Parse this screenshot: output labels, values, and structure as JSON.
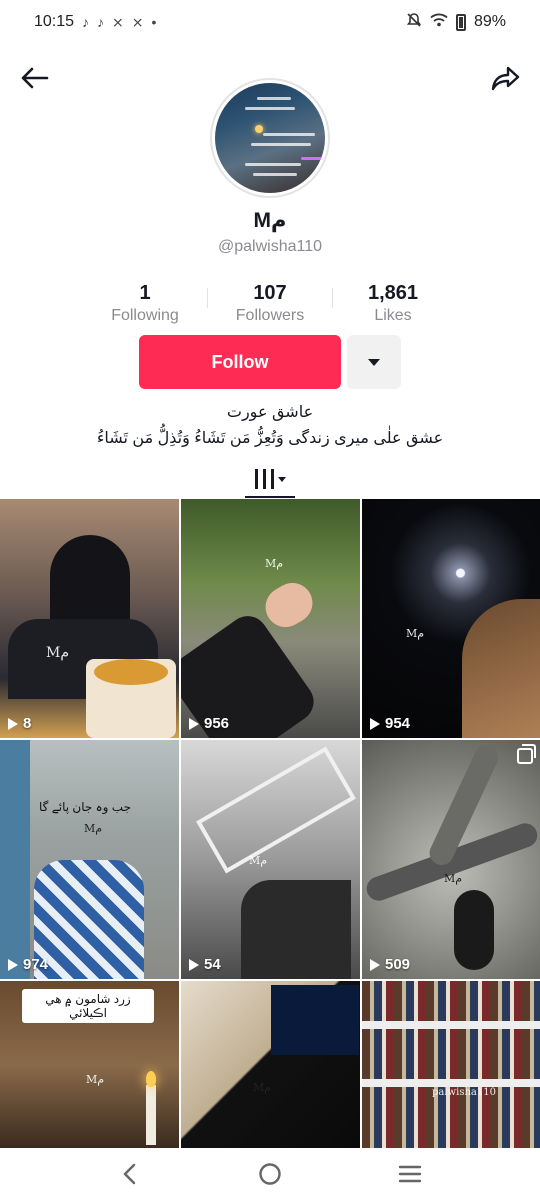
{
  "status_bar": {
    "time": "10:15",
    "battery": "89%",
    "icons": [
      "tiktok-notification-icon",
      "tiktok-notification-icon",
      "capcut-icon",
      "capcut-icon",
      "dot-icon",
      "mute-icon",
      "wifi-icon",
      "battery-icon"
    ]
  },
  "nav": {
    "back_icon": "back-arrow-icon",
    "share_icon": "share-arrow-icon"
  },
  "profile": {
    "display_name": "Mم",
    "username": "@palwisha110"
  },
  "stats": {
    "following_count": "1",
    "following_label": "Following",
    "followers_count": "107",
    "followers_label": "Followers",
    "likes_count": "1,861",
    "likes_label": "Likes"
  },
  "actions": {
    "follow_label": "Follow",
    "more_icon": "dropdown-triangle-icon"
  },
  "bio": {
    "line1": "عاشق عورت",
    "line2": "عشق علٰی میری زندگی  وَتُعِزُّ مَن تَشَاءُ وَتُذِلُّ مَن تَشَاءُ"
  },
  "tabs": {
    "active_icon": "videos-grid-icon"
  },
  "grid": {
    "videos": [
      {
        "views": "8",
        "watermark": "Mم"
      },
      {
        "views": "956",
        "watermark": "Mم"
      },
      {
        "views": "954",
        "watermark": "Mم"
      },
      {
        "views": "974",
        "watermark": "Mم",
        "caption": "جب وہ جان پائے گا"
      },
      {
        "views": "54",
        "watermark": "Mم"
      },
      {
        "views": "509",
        "watermark": "Mم",
        "multi": true
      },
      {
        "views": "",
        "watermark": "Mم",
        "caption": "زرد شامون ۾ ھي اڪيلائي"
      },
      {
        "views": "",
        "watermark": "Mم"
      },
      {
        "views": "",
        "watermark": "palwisha110"
      }
    ]
  },
  "colors": {
    "accent": "#fe2c55",
    "secondary_button": "#f1f1f2",
    "text_primary": "#161823",
    "text_secondary": "#8a8b91"
  },
  "system_nav": {
    "back_icon": "android-back-icon",
    "home_icon": "android-home-icon",
    "recents_icon": "android-recents-icon"
  }
}
